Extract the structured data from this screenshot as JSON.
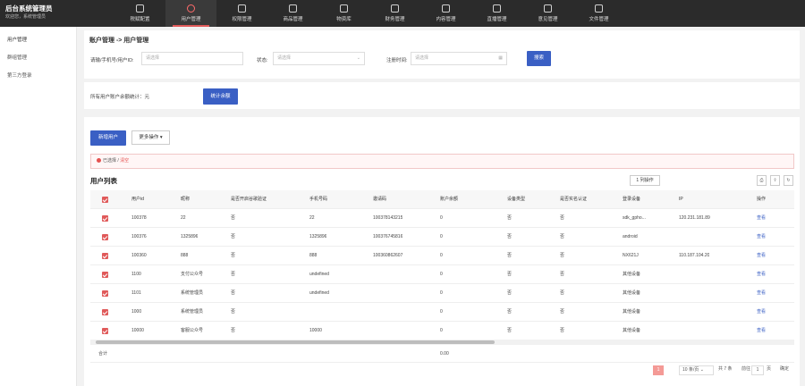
{
  "brand": {
    "title": "后台系统管理员",
    "subtitle": "欢迎您，系统管理员"
  },
  "nav": [
    {
      "label": "税赋配置",
      "icon": "gear-icon"
    },
    {
      "label": "用户管理",
      "icon": "user-icon"
    },
    {
      "label": "权限管理",
      "icon": "shield-icon"
    },
    {
      "label": "商品管理",
      "icon": "box-icon"
    },
    {
      "label": "物资库",
      "icon": "warehouse-icon"
    },
    {
      "label": "财务管理",
      "icon": "finance-icon"
    },
    {
      "label": "内容管理",
      "icon": "document-icon"
    },
    {
      "label": "直播管理",
      "icon": "monitor-icon"
    },
    {
      "label": "意见管理",
      "icon": "feedback-icon"
    },
    {
      "label": "文件管理",
      "icon": "folder-icon"
    }
  ],
  "sidebar": [
    {
      "label": "用户管理"
    },
    {
      "label": "群组管理"
    },
    {
      "label": "第三方登录"
    }
  ],
  "breadcrumb": "账户管理 -> 用户管理",
  "filters": {
    "account_label": "请输/手机号/用户ID:",
    "account_placeholder": "请选择",
    "status_label": "状态:",
    "status_placeholder": "请选择",
    "time_label": "注册时间:",
    "time_placeholder": "请选择",
    "search_button": "搜索"
  },
  "stats": {
    "label": "所有用户账户余额统计：",
    "value": "元",
    "button": "统计余额"
  },
  "toolbar": {
    "add_button": "新增用户",
    "more_button": "更多操作 ▾"
  },
  "alert": {
    "text": "已选择 / ",
    "clear": "清空"
  },
  "list": {
    "title": "用户列表",
    "col_config": "1 列操作"
  },
  "columns": [
    "用户id",
    "昵称",
    "是否开启谷歌验证",
    "手机号码",
    "邀请码",
    "账户余额",
    "设备类型",
    "是否实名认证",
    "登录设备",
    "IP",
    "操作"
  ],
  "rows": [
    [
      "100378",
      "22",
      "否",
      "22",
      "100378143215",
      "0",
      "否",
      "否",
      "sdk_gpho...",
      "120.231.181.89",
      "查看"
    ],
    [
      "100376",
      "1325896",
      "否",
      "1325896",
      "100376745816",
      "0",
      "否",
      "否",
      "android",
      "",
      "查看"
    ],
    [
      "100360",
      "888",
      "否",
      "888",
      "100360862607",
      "0",
      "否",
      "否",
      "NX621J",
      "110.187.104.20",
      "查看"
    ],
    [
      "1100",
      "支付公众号",
      "否",
      "undefined",
      "",
      "0",
      "否",
      "否",
      "其他设备",
      "",
      "查看"
    ],
    [
      "1101",
      "系统管理员",
      "否",
      "undefined",
      "",
      "0",
      "否",
      "否",
      "其他设备",
      "",
      "查看"
    ],
    [
      "1000",
      "系统管理员",
      "否",
      "",
      "",
      "0",
      "否",
      "否",
      "其他设备",
      "",
      "查看"
    ],
    [
      "10000",
      "客服公众号",
      "否",
      "10000",
      "",
      "0",
      "否",
      "否",
      "其他设备",
      "",
      "查看"
    ]
  ],
  "summary": {
    "label": "合计",
    "value": "0.00"
  },
  "pagination": {
    "current": "1",
    "page_size": "10 条/页",
    "total": "共 7 条",
    "goto_label": "前往",
    "goto_value": "1",
    "goto_suffix": "页",
    "confirm": "确定"
  },
  "colors": {
    "accent": "#3a5fc4",
    "danger": "#e05a5a",
    "topbar": "#2b2b2b"
  }
}
